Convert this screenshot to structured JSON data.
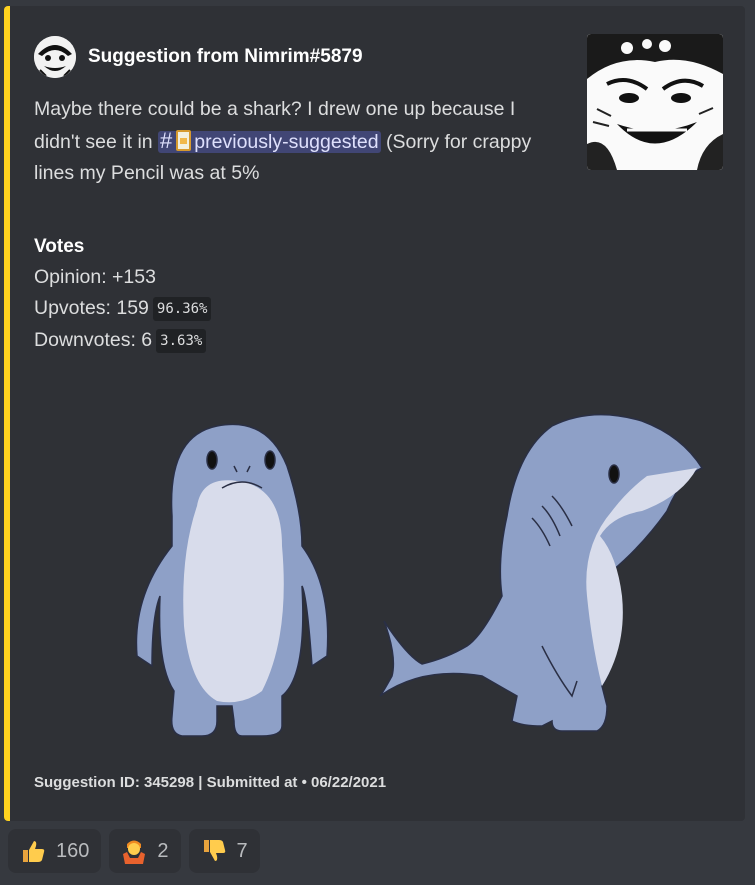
{
  "embed": {
    "accent_color": "#ffd21f",
    "author": {
      "name": "Suggestion from Nimrim#5879",
      "avatar_icon": "manga-avatar-icon"
    },
    "description": {
      "text_before": "Maybe there could be a shark? I drew one up because I didn't see it in ",
      "channel_mention": {
        "hash": "#",
        "emoji": "memo-icon",
        "name": "previously-suggested"
      },
      "text_after": " (Sorry for crappy lines my Pencil was at 5%"
    },
    "votes": {
      "title": "Votes",
      "opinion": "Opinion: +153",
      "upvotes_label": "Upvotes: 159",
      "upvotes_pct": "96.36%",
      "downvotes_label": "Downvotes: 6",
      "downvotes_pct": "3.63%"
    },
    "image": {
      "icon": "shark-drawing-icon"
    },
    "footer": "Suggestion ID: 345298 | Submitted at • 06/22/2021"
  },
  "reactions": [
    {
      "emoji": "thumbs-up-icon",
      "count": "160"
    },
    {
      "emoji": "person-shrugging-icon",
      "count": "2"
    },
    {
      "emoji": "thumbs-down-icon",
      "count": "7"
    }
  ]
}
